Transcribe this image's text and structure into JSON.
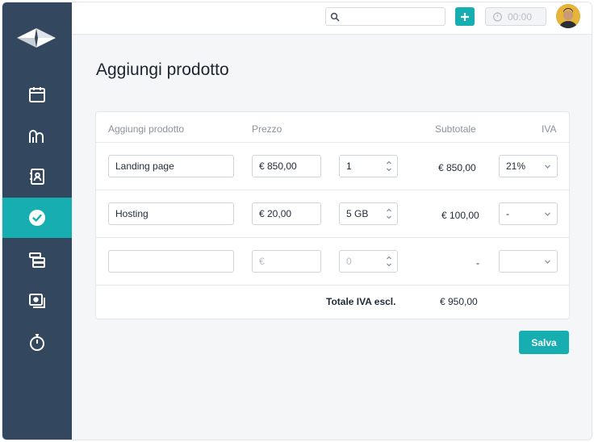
{
  "sidebar": {
    "items": [
      {
        "icon": "calendar-icon",
        "active": false
      },
      {
        "icon": "team-icon",
        "active": false
      },
      {
        "icon": "contacts-icon",
        "active": false
      },
      {
        "icon": "check-circle-icon",
        "active": true
      },
      {
        "icon": "layers-icon",
        "active": false
      },
      {
        "icon": "invoice-icon",
        "active": false
      },
      {
        "icon": "stopwatch-icon",
        "active": false
      }
    ]
  },
  "topbar": {
    "search_placeholder": "",
    "timer": "00:00"
  },
  "page": {
    "title": "Aggiungi prodotto"
  },
  "table": {
    "headers": {
      "product": "Aggiungi prodotto",
      "price": "Prezzo",
      "subtotal": "Subtotale",
      "vat": "IVA"
    },
    "rows": [
      {
        "product": "Landing page",
        "price": "€ 850,00",
        "qty": "1",
        "subtotal": "€ 850,00",
        "vat": "21%"
      },
      {
        "product": "Hosting",
        "price": "€ 20,00",
        "qty": "5 GB",
        "subtotal": "€ 100,00",
        "vat": "-"
      },
      {
        "product": "",
        "price_placeholder": "€",
        "qty_placeholder": "0",
        "subtotal": "-",
        "vat": ""
      }
    ],
    "total_label": "Totale IVA escl.",
    "total_value": "€ 950,00"
  },
  "actions": {
    "save_label": "Salva"
  },
  "colors": {
    "sidebar": "#33485e",
    "accent": "#16aeb0"
  }
}
